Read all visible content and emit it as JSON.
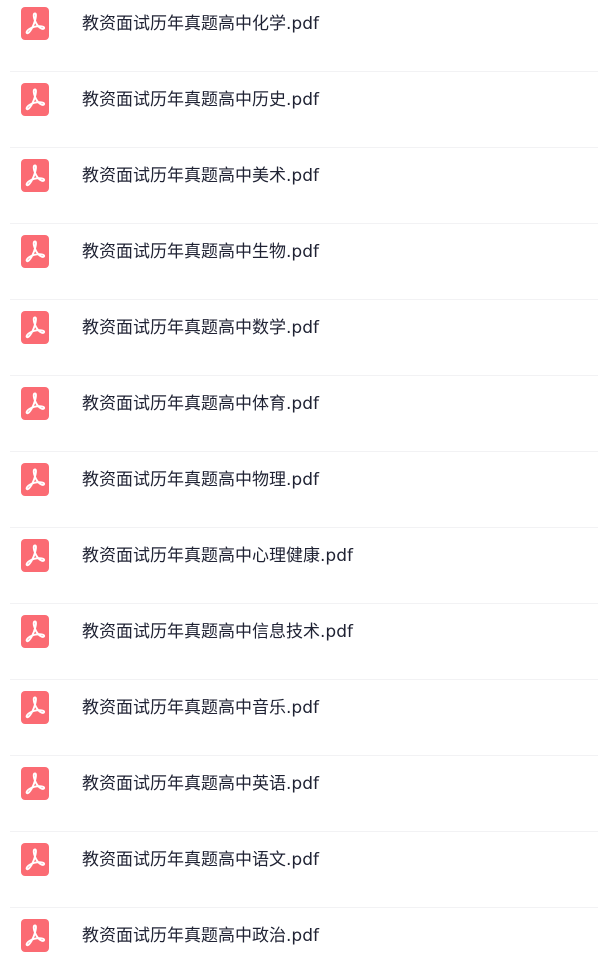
{
  "files": [
    {
      "name": "教资面试历年真题高中化学.pdf",
      "icon": "pdf-file-icon"
    },
    {
      "name": "教资面试历年真题高中历史.pdf",
      "icon": "pdf-file-icon"
    },
    {
      "name": "教资面试历年真题高中美术.pdf",
      "icon": "pdf-file-icon"
    },
    {
      "name": "教资面试历年真题高中生物.pdf",
      "icon": "pdf-file-icon"
    },
    {
      "name": "教资面试历年真题高中数学.pdf",
      "icon": "pdf-file-icon"
    },
    {
      "name": "教资面试历年真题高中体育.pdf",
      "icon": "pdf-file-icon"
    },
    {
      "name": "教资面试历年真题高中物理.pdf",
      "icon": "pdf-file-icon"
    },
    {
      "name": "教资面试历年真题高中心理健康.pdf",
      "icon": "pdf-file-icon"
    },
    {
      "name": "教资面试历年真题高中信息技术.pdf",
      "icon": "pdf-file-icon"
    },
    {
      "name": "教资面试历年真题高中音乐.pdf",
      "icon": "pdf-file-icon"
    },
    {
      "name": "教资面试历年真题高中英语.pdf",
      "icon": "pdf-file-icon"
    },
    {
      "name": "教资面试历年真题高中语文.pdf",
      "icon": "pdf-file-icon"
    },
    {
      "name": "教资面试历年真题高中政治.pdf",
      "icon": "pdf-file-icon"
    }
  ],
  "colors": {
    "icon_background": "#fb6b73",
    "icon_symbol": "#ffffff",
    "text": "#1f2233",
    "divider": "#f2f2f4"
  }
}
